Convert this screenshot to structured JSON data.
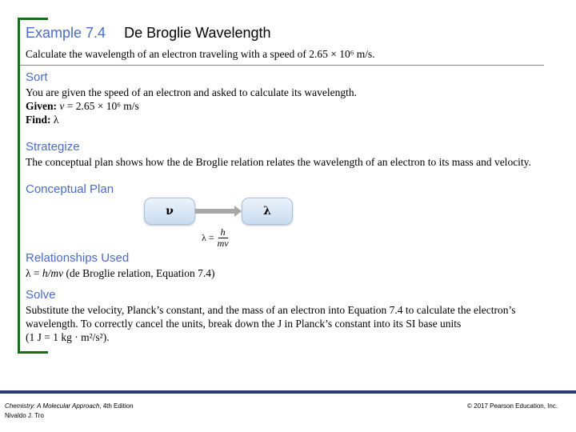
{
  "header": {
    "example_number": "Example 7.4",
    "example_title": "De Broglie Wavelength",
    "problem": "Calculate the wavelength of an electron traveling with a speed of 2.65 × 10⁶ m/s."
  },
  "sort": {
    "heading": "Sort",
    "text": "You are given the speed of an electron and asked to calculate its wavelength.",
    "given_label": "Given:",
    "given_var": "ν",
    "given_value": " = 2.65 × 10⁶ m/s",
    "find_label": "Find:",
    "find_value": "λ"
  },
  "strategize": {
    "heading": "Strategize",
    "text": "The conceptual plan shows how the de Broglie relation relates the wavelength of an electron to its mass and velocity."
  },
  "conceptual_plan": {
    "heading": "Conceptual Plan",
    "from_box": "ν",
    "to_box": "λ",
    "formula_lhs": "λ =",
    "formula_num": "h",
    "formula_den": "mv"
  },
  "relationships": {
    "heading": "Relationships Used",
    "lhs": "λ = ",
    "expr": "h/mv",
    "note": " (de Broglie relation, Equation 7.4)"
  },
  "solve": {
    "heading": "Solve",
    "line1": "Substitute the velocity, Planck’s constant, and the mass of an electron into Equation 7.4 to calculate the electron’s",
    "line2": "wavelength. To correctly cancel the units, break down the J in Planck’s constant into its SI base units",
    "line3": "(1 J = 1 kg · m²/s²)."
  },
  "footer": {
    "book_title": "Chemistry: A Molecular Approach",
    "edition": ", 4th Edition",
    "author": "Nivaldo J. Tro",
    "copyright": "© 2017 Pearson Education, Inc."
  },
  "colors": {
    "heading_blue": "#4a6cc8",
    "frame_green": "#1a6b1a",
    "footer_navy": "#2e3a78"
  }
}
